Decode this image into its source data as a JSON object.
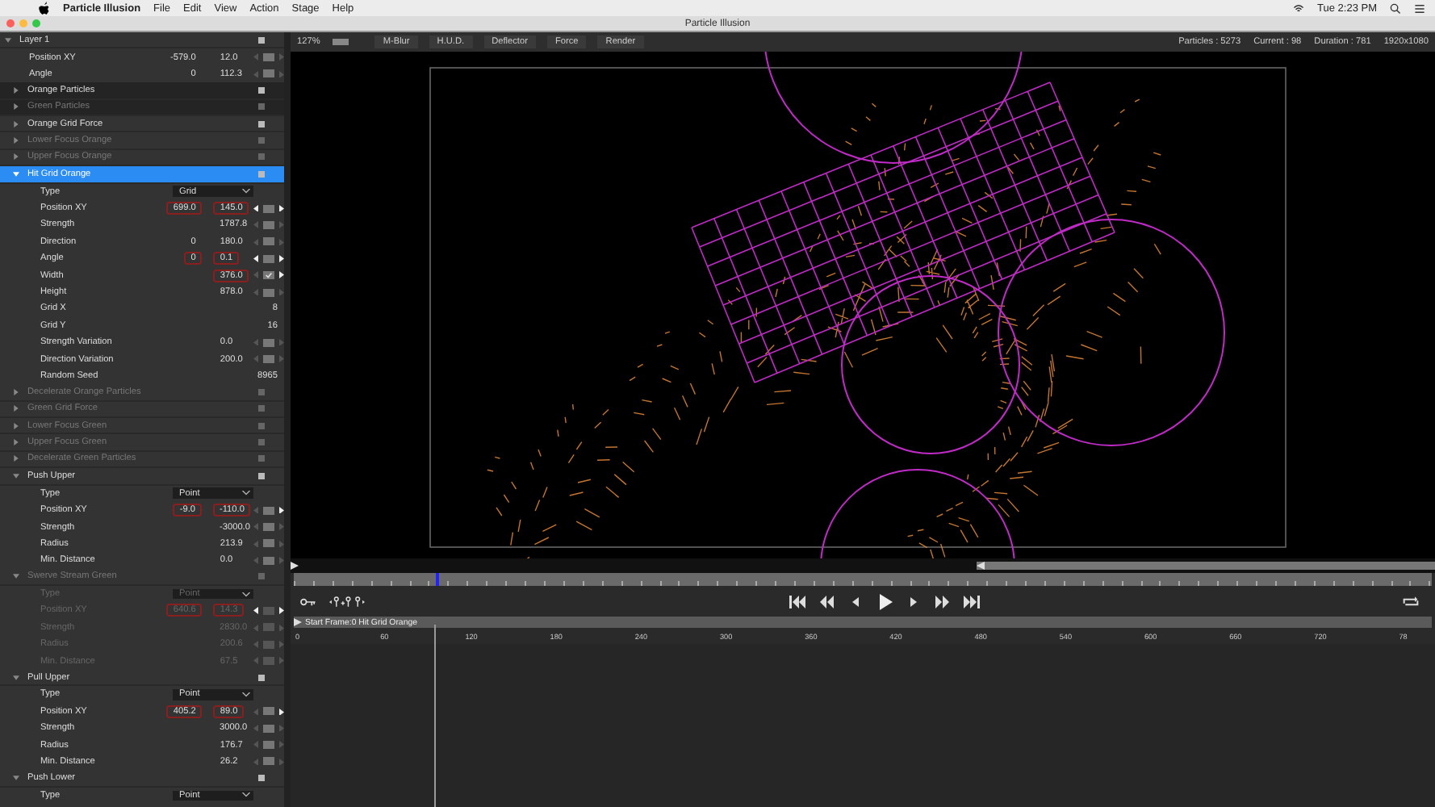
{
  "menu_bar": {
    "app": "Particle Illusion",
    "items": [
      "File",
      "Edit",
      "View",
      "Action",
      "Stage",
      "Help"
    ],
    "clock": "Tue 2:23 PM"
  },
  "window": {
    "title": "Particle Illusion"
  },
  "layers": [
    {
      "name": "Layer 1",
      "expanded": true,
      "params": [
        {
          "label": "Position XY",
          "kind": "pair",
          "values": [
            {
              "text": "-579.0",
              "keyed": false
            },
            {
              "text": "12.0",
              "keyed": false
            }
          ],
          "prev_key": false,
          "next_key": false,
          "checked": false
        },
        {
          "label": "Angle",
          "kind": "pair",
          "values": [
            {
              "text": "0",
              "keyed": false
            },
            {
              "text": "112.3",
              "keyed": false
            }
          ],
          "prev_key": false,
          "next_key": false,
          "checked": false
        }
      ],
      "items": [
        {
          "name": "Orange Particles",
          "kind": "emitter",
          "enabled": true,
          "expanded": false,
          "selected": false
        },
        {
          "name": "Green Particles",
          "kind": "emitter",
          "enabled": false,
          "expanded": false,
          "selected": false
        },
        {
          "name": "Orange Grid Force",
          "kind": "force",
          "enabled": true,
          "expanded": false,
          "selected": false
        },
        {
          "name": "Lower Focus Orange",
          "kind": "force",
          "enabled": false,
          "expanded": false,
          "selected": false
        },
        {
          "name": "Upper Focus Orange",
          "kind": "force",
          "enabled": false,
          "expanded": false,
          "selected": false
        },
        {
          "name": "Hit Grid Orange",
          "kind": "force",
          "enabled": true,
          "expanded": true,
          "selected": true,
          "params": [
            {
              "label": "Type",
              "kind": "dropdown",
              "value": "Grid"
            },
            {
              "label": "Position XY",
              "kind": "pair",
              "values": [
                {
                  "text": "699.0",
                  "keyed": true
                },
                {
                  "text": "145.0",
                  "keyed": true
                }
              ],
              "prev_key": true,
              "next_key": true,
              "checked": false
            },
            {
              "label": "Strength",
              "kind": "single",
              "values": [
                {
                  "text": "1787.8",
                  "keyed": false
                }
              ],
              "prev_key": false,
              "next_key": false,
              "checked": false
            },
            {
              "label": "Direction",
              "kind": "pair",
              "values": [
                {
                  "text": "0",
                  "keyed": false
                },
                {
                  "text": "180.0",
                  "keyed": false
                }
              ],
              "prev_key": false,
              "next_key": false,
              "checked": false
            },
            {
              "label": "Angle",
              "kind": "pair",
              "values": [
                {
                  "text": "0",
                  "keyed": true
                },
                {
                  "text": "0.1",
                  "keyed": true
                }
              ],
              "prev_key": true,
              "next_key": true,
              "checked": false
            },
            {
              "label": "Width",
              "kind": "single",
              "values": [
                {
                  "text": "376.0",
                  "keyed": true
                }
              ],
              "prev_key": false,
              "next_key": true,
              "checked": true
            },
            {
              "label": "Height",
              "kind": "single",
              "values": [
                {
                  "text": "878.0",
                  "keyed": false
                }
              ],
              "prev_key": false,
              "next_key": false,
              "checked": false
            },
            {
              "label": "Grid X",
              "kind": "int",
              "value": "8"
            },
            {
              "label": "Grid Y",
              "kind": "int",
              "value": "16"
            },
            {
              "label": "Strength Variation",
              "kind": "single",
              "values": [
                {
                  "text": "0.0",
                  "keyed": false
                }
              ],
              "prev_key": false,
              "next_key": false,
              "checked": false
            },
            {
              "label": "Direction Variation",
              "kind": "single",
              "values": [
                {
                  "text": "200.0",
                  "keyed": false
                }
              ],
              "prev_key": false,
              "next_key": false,
              "checked": false
            },
            {
              "label": "Random Seed",
              "kind": "int",
              "value": "8965"
            }
          ]
        },
        {
          "name": "Decelerate Orange Particles",
          "kind": "force",
          "enabled": false,
          "expanded": false,
          "selected": false
        },
        {
          "name": "Green Grid Force",
          "kind": "force",
          "enabled": false,
          "expanded": false,
          "selected": false
        },
        {
          "name": "Lower Focus Green",
          "kind": "force",
          "enabled": false,
          "expanded": false,
          "selected": false
        },
        {
          "name": "Upper Focus Green",
          "kind": "force",
          "enabled": false,
          "expanded": false,
          "selected": false
        },
        {
          "name": "Decelerate Green Particles",
          "kind": "force",
          "enabled": false,
          "expanded": false,
          "selected": false
        },
        {
          "name": "Push Upper",
          "kind": "force",
          "enabled": true,
          "expanded": true,
          "selected": false,
          "params": [
            {
              "label": "Type",
              "kind": "dropdown",
              "value": "Point"
            },
            {
              "label": "Position XY",
              "kind": "pair",
              "values": [
                {
                  "text": "-9.0",
                  "keyed": true
                },
                {
                  "text": "-110.0",
                  "keyed": true
                }
              ],
              "prev_key": false,
              "next_key": true,
              "checked": false
            },
            {
              "label": "Strength",
              "kind": "single",
              "values": [
                {
                  "text": "-3000.0",
                  "keyed": false
                }
              ],
              "prev_key": false,
              "next_key": false,
              "checked": false
            },
            {
              "label": "Radius",
              "kind": "single",
              "values": [
                {
                  "text": "213.9",
                  "keyed": false
                }
              ],
              "prev_key": false,
              "next_key": false,
              "checked": false
            },
            {
              "label": "Min. Distance",
              "kind": "single",
              "values": [
                {
                  "text": "0.0",
                  "keyed": false
                }
              ],
              "prev_key": false,
              "next_key": false,
              "checked": false
            }
          ]
        },
        {
          "name": "Swerve Stream Green",
          "kind": "force",
          "enabled": false,
          "expanded": true,
          "selected": false,
          "params": [
            {
              "label": "Type",
              "kind": "dropdown",
              "value": "Point"
            },
            {
              "label": "Position XY",
              "kind": "pair",
              "values": [
                {
                  "text": "640.6",
                  "keyed": true
                },
                {
                  "text": "14.3",
                  "keyed": true
                }
              ],
              "prev_key": true,
              "next_key": true,
              "checked": false
            },
            {
              "label": "Strength",
              "kind": "single",
              "values": [
                {
                  "text": "2830.0",
                  "keyed": false
                }
              ],
              "prev_key": false,
              "next_key": false,
              "checked": false
            },
            {
              "label": "Radius",
              "kind": "single",
              "values": [
                {
                  "text": "200.6",
                  "keyed": false
                }
              ],
              "prev_key": false,
              "next_key": false,
              "checked": false
            },
            {
              "label": "Min. Distance",
              "kind": "single",
              "values": [
                {
                  "text": "67.5",
                  "keyed": false
                }
              ],
              "prev_key": false,
              "next_key": false,
              "checked": false
            }
          ]
        },
        {
          "name": "Pull Upper",
          "kind": "force",
          "enabled": true,
          "expanded": true,
          "selected": false,
          "params": [
            {
              "label": "Type",
              "kind": "dropdown",
              "value": "Point"
            },
            {
              "label": "Position XY",
              "kind": "pair",
              "values": [
                {
                  "text": "405.2",
                  "keyed": true
                },
                {
                  "text": "89.0",
                  "keyed": true
                }
              ],
              "prev_key": false,
              "next_key": true,
              "checked": false
            },
            {
              "label": "Strength",
              "kind": "single",
              "values": [
                {
                  "text": "3000.0",
                  "keyed": false
                }
              ],
              "prev_key": false,
              "next_key": false,
              "checked": false
            },
            {
              "label": "Radius",
              "kind": "single",
              "values": [
                {
                  "text": "176.7",
                  "keyed": false
                }
              ],
              "prev_key": false,
              "next_key": false,
              "checked": false
            },
            {
              "label": "Min. Distance",
              "kind": "single",
              "values": [
                {
                  "text": "26.2",
                  "keyed": false
                }
              ],
              "prev_key": false,
              "next_key": false,
              "checked": false
            }
          ]
        },
        {
          "name": "Push Lower",
          "kind": "force",
          "enabled": true,
          "expanded": true,
          "selected": false,
          "params": [
            {
              "label": "Type",
              "kind": "dropdown",
              "value": "Point"
            }
          ]
        }
      ]
    }
  ],
  "viewer": {
    "zoom": "127%",
    "buttons": [
      "M-Blur",
      "H.U.D.",
      "Deflector",
      "Force",
      "Render"
    ],
    "stats": [
      "Particles : 5273",
      "Current : 98",
      "Duration : 781",
      "1920x1080"
    ]
  },
  "timeline": {
    "playhead": {
      "level": 0.125
    },
    "track_label": "Start Frame:0 Hit Grid Orange",
    "ruler": [
      "0",
      "60",
      "120",
      "180",
      "240",
      "300",
      "360",
      "420",
      "480",
      "540",
      "600",
      "660",
      "720",
      "78"
    ]
  }
}
